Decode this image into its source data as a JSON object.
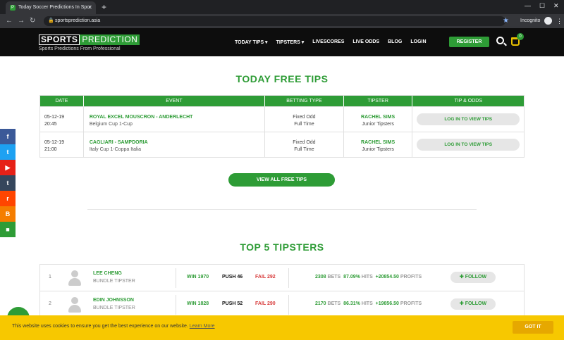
{
  "browser": {
    "tab_title": "Today Soccer Predictions In Spor",
    "tab_favicon": "P",
    "url": "sportsprediction.asia",
    "mode_label": "Incognito"
  },
  "header": {
    "logo_primary": "SPORTS",
    "logo_secondary": "PREDICTION",
    "tagline": "Sports Predictions From Professional",
    "nav": [
      "TODAY TIPS ▾",
      "TIPSTERS ▾",
      "LIVESCORES",
      "LIVE ODDS",
      "BLOG",
      "LOGIN"
    ],
    "register_label": "REGISTER",
    "cart_count": "0",
    "accent_color": "#2e9c36"
  },
  "free_tips": {
    "title": "TODAY FREE TIPS",
    "columns": [
      "DATE",
      "EVENT",
      "BETTING TYPE",
      "TIPSTER",
      "TIP & ODDS"
    ],
    "rows": [
      {
        "date": "05-12-19",
        "time": "20:45",
        "event": "ROYAL EXCEL MOUSCRON - ANDERLECHT",
        "league": "Belgium Cup 1-Cup",
        "bet_type": "Fixed Odd",
        "bet_period": "Full Time",
        "tipster": "RACHEL SIMS",
        "tipster_level": "Junior Tipsters",
        "action": "LOG IN TO VIEW TIPS"
      },
      {
        "date": "05-12-19",
        "time": "21:00",
        "event": "CAGLIARI - SAMPDORIA",
        "league": "Italy Cup 1-Coppa Italia",
        "bet_type": "Fixed Odd",
        "bet_period": "Full Time",
        "tipster": "RACHEL SIMS",
        "tipster_level": "Junior Tipsters",
        "action": "LOG IN TO VIEW TIPS"
      }
    ],
    "view_all_label": "VIEW ALL FREE TIPS"
  },
  "top_tipsters": {
    "title": "TOP 5 TIPSTERS",
    "rows": [
      {
        "rank": "1",
        "name": "LEE CHENG",
        "role": "BUNDLE TIPSTER",
        "win": "WIN 1970",
        "push": "PUSH 46",
        "fail": "FAIL 292",
        "bets": "2308",
        "bets_label": "BETS",
        "hits": "87.09%",
        "hits_label": "HITS",
        "profits": "+20854.50",
        "profits_label": "PROFITS",
        "follow_label": "FOLLOW"
      },
      {
        "rank": "2",
        "name": "EDIN JOHNSSON",
        "role": "BUNDLE TIPSTER",
        "win": "WIN 1828",
        "push": "PUSH 52",
        "fail": "FAIL 290",
        "bets": "2170",
        "bets_label": "BETS",
        "hits": "86.31%",
        "hits_label": "HITS",
        "profits": "+19856.50",
        "profits_label": "PROFITS",
        "follow_label": "FOLLOW"
      }
    ]
  },
  "social": [
    {
      "icon": "facebook-icon",
      "glyph": "f",
      "color": "#3b5998"
    },
    {
      "icon": "twitter-icon",
      "glyph": "t",
      "color": "#1da1f2"
    },
    {
      "icon": "youtube-icon",
      "glyph": "▶",
      "color": "#e62117"
    },
    {
      "icon": "tumblr-icon",
      "glyph": "t",
      "color": "#35465c"
    },
    {
      "icon": "reddit-icon",
      "glyph": "r",
      "color": "#ff4500"
    },
    {
      "icon": "blogger-icon",
      "glyph": "B",
      "color": "#f57d00"
    },
    {
      "icon": "video-icon",
      "glyph": "■",
      "color": "#2e9c36"
    }
  ],
  "cookie": {
    "message": "This website uses cookies to ensure you get the best experience on our website.",
    "link": "Learn More",
    "button": "GOT IT"
  }
}
